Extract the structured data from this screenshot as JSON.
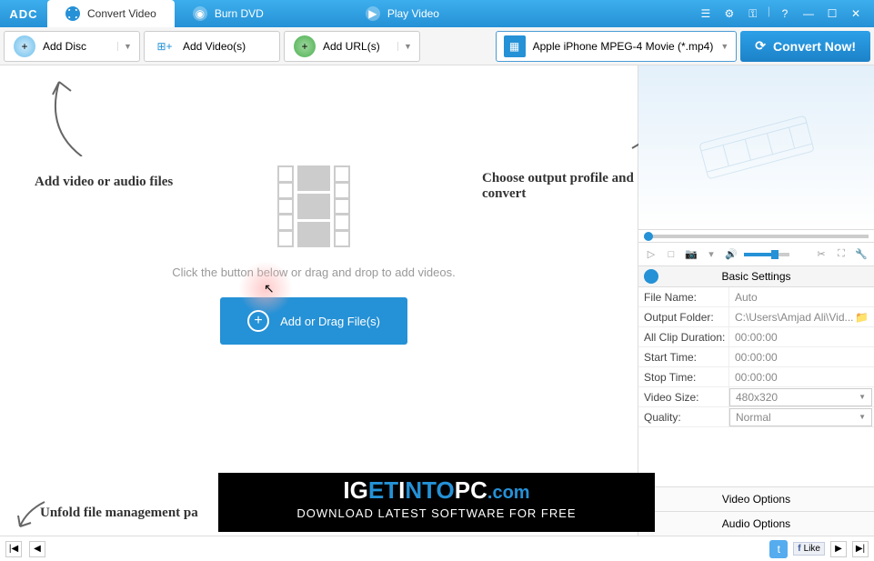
{
  "app": {
    "logo": "ADC"
  },
  "tabs": [
    {
      "label": "Convert Video",
      "active": true
    },
    {
      "label": "Burn DVD",
      "active": false
    },
    {
      "label": "Play Video",
      "active": false
    }
  ],
  "toolbar": {
    "add_disc": "Add Disc",
    "add_videos": "Add Video(s)",
    "add_urls": "Add URL(s)",
    "profile": "Apple iPhone MPEG-4 Movie (*.mp4)",
    "convert": "Convert Now!"
  },
  "hints": {
    "add_files": "Add video or audio files",
    "choose_profile": "Choose output profile and convert",
    "unfold": "Unfold file management pa",
    "drop_text": "Click the button below or drag and drop to add videos.",
    "add_button": "Add or Drag File(s)"
  },
  "settings": {
    "header": "Basic Settings",
    "rows": [
      {
        "label": "File Name:",
        "value": "Auto",
        "type": "text"
      },
      {
        "label": "Output Folder:",
        "value": "C:\\Users\\Amjad Ali\\Vid...",
        "type": "folder"
      },
      {
        "label": "All Clip Duration:",
        "value": "00:00:00",
        "type": "text"
      },
      {
        "label": "Start Time:",
        "value": "00:00:00",
        "type": "text"
      },
      {
        "label": "Stop Time:",
        "value": "00:00:00",
        "type": "text"
      },
      {
        "label": "Video Size:",
        "value": "480x320",
        "type": "dropdown"
      },
      {
        "label": "Quality:",
        "value": "Normal",
        "type": "dropdown"
      }
    ],
    "video_options": "Video Options",
    "audio_options": "Audio Options"
  },
  "status": {
    "fb_like": "Like"
  },
  "watermark": {
    "line1_a": "IG",
    "line1_b": "ET",
    "line1_c": "I",
    "line1_d": "NTO",
    "line1_e": "PC",
    "line1_suffix": ".com",
    "line2": "Download Latest Software for Free"
  }
}
